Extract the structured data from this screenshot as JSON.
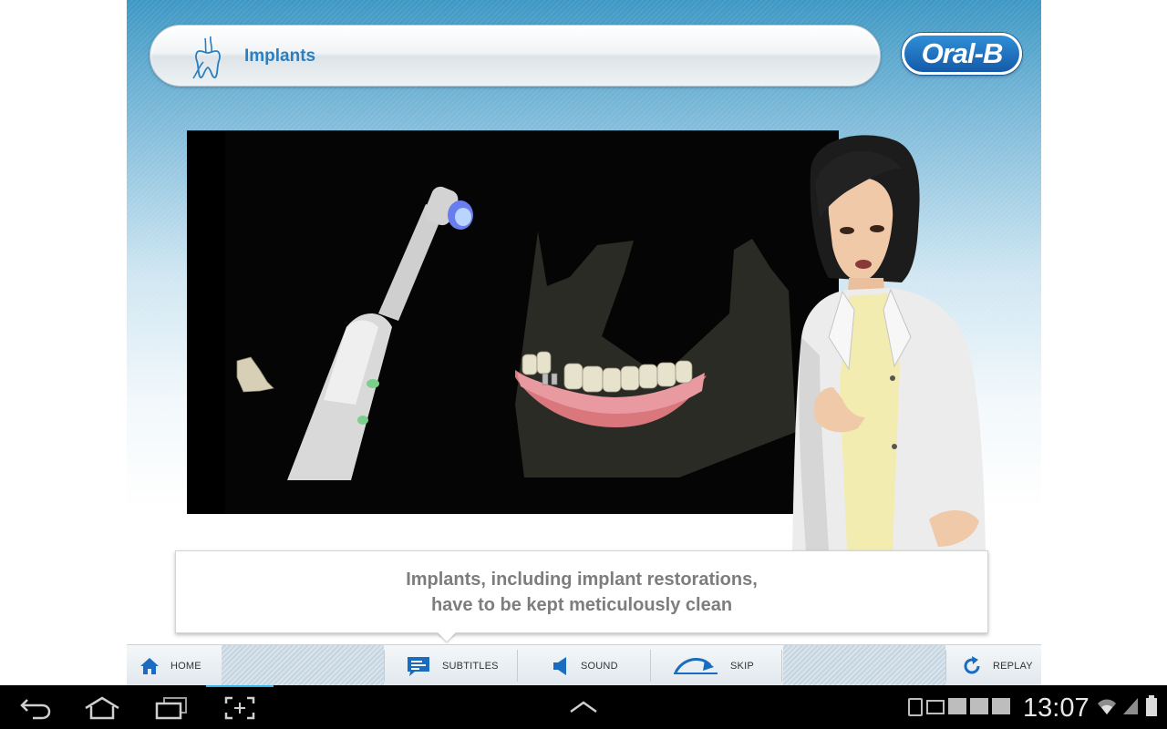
{
  "header": {
    "title": "Implants"
  },
  "brand": {
    "logo_text": "Oral-B"
  },
  "subtitle": {
    "line1": "Implants, including implant restorations,",
    "line2": "have to be kept meticulously clean"
  },
  "toolbar": {
    "home": "HOME",
    "subtitles": "SUBTITLES",
    "sound": "SOUND",
    "skip": "SKIP",
    "replay": "REPLAY"
  },
  "system_bar": {
    "time": "13:07"
  },
  "colors": {
    "accent": "#2a7fc0",
    "brand_blue": "#1a6cc0",
    "subtitle_text": "#7d7d7d"
  },
  "icons": [
    "tooth-icon",
    "home-icon",
    "subtitles-icon",
    "sound-icon",
    "skip-icon",
    "replay-icon",
    "back-icon",
    "nav-home-icon",
    "recent-apps-icon",
    "screenshot-icon",
    "chevron-up-icon",
    "wifi-icon",
    "signal-icon"
  ]
}
